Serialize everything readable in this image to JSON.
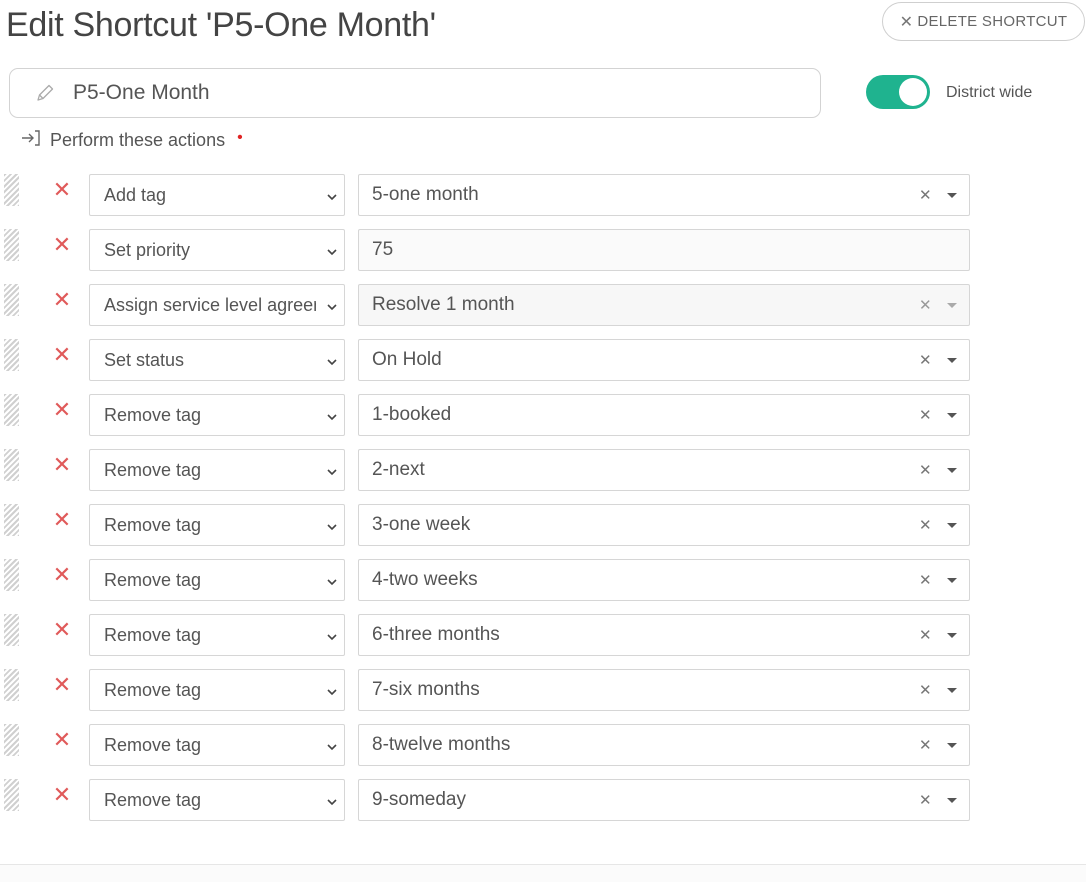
{
  "header": {
    "title": "Edit Shortcut 'P5-One Month'",
    "delete_label": "DELETE SHORTCUT",
    "delete_icon": "close-icon"
  },
  "name_field": {
    "value": "P5-One Month",
    "icon": "pencil-icon"
  },
  "district_wide": {
    "label": "District wide",
    "on": true,
    "color": "#1fb38f"
  },
  "actions_section": {
    "label": "Perform these actions",
    "required_mark": "•",
    "icon": "sign-in-arrow-icon"
  },
  "colors": {
    "remove_x": "#e05a5a",
    "required": "#e02424"
  },
  "actions": [
    {
      "action": "Add tag",
      "value": "5-one month",
      "kind": "select"
    },
    {
      "action": "Set priority",
      "value": "75",
      "kind": "text"
    },
    {
      "action": "Assign service level agreement",
      "value": "Resolve 1 month",
      "kind": "select-disabled"
    },
    {
      "action": "Set status",
      "value": "On Hold",
      "kind": "select"
    },
    {
      "action": "Remove tag",
      "value": "1-booked",
      "kind": "select"
    },
    {
      "action": "Remove tag",
      "value": "2-next",
      "kind": "select"
    },
    {
      "action": "Remove tag",
      "value": "3-one week",
      "kind": "select"
    },
    {
      "action": "Remove tag",
      "value": "4-two weeks",
      "kind": "select"
    },
    {
      "action": "Remove tag",
      "value": "6-three months",
      "kind": "select"
    },
    {
      "action": "Remove tag",
      "value": "7-six months",
      "kind": "select"
    },
    {
      "action": "Remove tag",
      "value": "8-twelve months",
      "kind": "select"
    },
    {
      "action": "Remove tag",
      "value": "9-someday",
      "kind": "select"
    }
  ]
}
